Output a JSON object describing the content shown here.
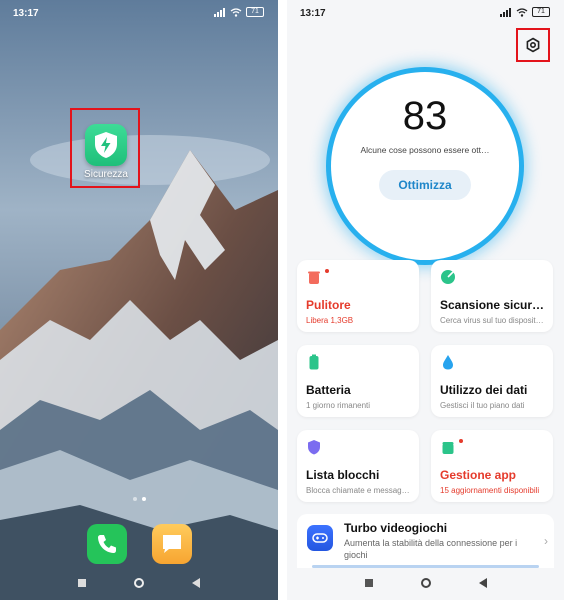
{
  "left": {
    "status_time": "13:17",
    "battery": "71",
    "app_label": "Sicurezza"
  },
  "right": {
    "status_time": "13:17",
    "battery": "71",
    "score": "83",
    "score_description": "Alcune cose possono essere ott…",
    "optimize_label": "Ottimizza",
    "cards": [
      {
        "title": "Pulitore",
        "subtitle": "Libera 1,3GB"
      },
      {
        "title": "Scansione sicurez…",
        "subtitle": "Cerca virus sul tuo disposit…"
      },
      {
        "title": "Batteria",
        "subtitle": "1 giorno  rimanenti"
      },
      {
        "title": "Utilizzo dei dati",
        "subtitle": "Gestisci il tuo piano dati"
      },
      {
        "title": "Lista blocchi",
        "subtitle": "Blocca chiamate e messag…"
      },
      {
        "title": "Gestione app",
        "subtitle": "15 aggiornamenti disponibili"
      }
    ],
    "turbo": {
      "title": "Turbo videogiochi",
      "subtitle": "Aumenta la stabilità della connessione per i giochi"
    }
  },
  "colors": {
    "highlight": "#e3131b",
    "ring": "#27b0ee",
    "alert_red": "#e53b2c"
  }
}
